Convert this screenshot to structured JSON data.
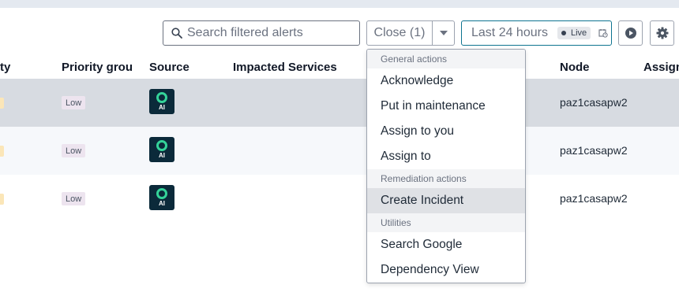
{
  "toolbar": {
    "search_placeholder": "Search filtered alerts",
    "close_label": "Close (1)",
    "time_range_label": "Last 24 hours",
    "live_label": "Live"
  },
  "table": {
    "columns": [
      "ty",
      "Priority grou",
      "Source",
      "Impacted Services",
      "Node",
      "Assign"
    ],
    "rows": [
      {
        "priority_group": "Low",
        "source": "AI",
        "node": "paz1casapw2"
      },
      {
        "priority_group": "Low",
        "source": "AI",
        "node": "paz1casapw2"
      },
      {
        "priority_group": "Low",
        "source": "AI",
        "node": "paz1casapw2"
      }
    ]
  },
  "menu": {
    "general_header": "General actions",
    "general_items": [
      "Acknowledge",
      "Put in maintenance",
      "Assign to you",
      "Assign to"
    ],
    "remediation_header": "Remediation actions",
    "remediation_items": [
      "Create Incident"
    ],
    "utilities_header": "Utilities",
    "utilities_items": [
      "Search Google",
      "Dependency View"
    ]
  },
  "colors": {
    "accent_border": "#0e7490",
    "source_icon_bg": "#0b2a3a",
    "source_icon_ring": "#34d399",
    "selected_row": "#d7dbe1"
  },
  "icons": [
    "search-icon",
    "chevron-down-icon",
    "calendar-clock-icon",
    "play-icon",
    "gear-icon"
  ]
}
